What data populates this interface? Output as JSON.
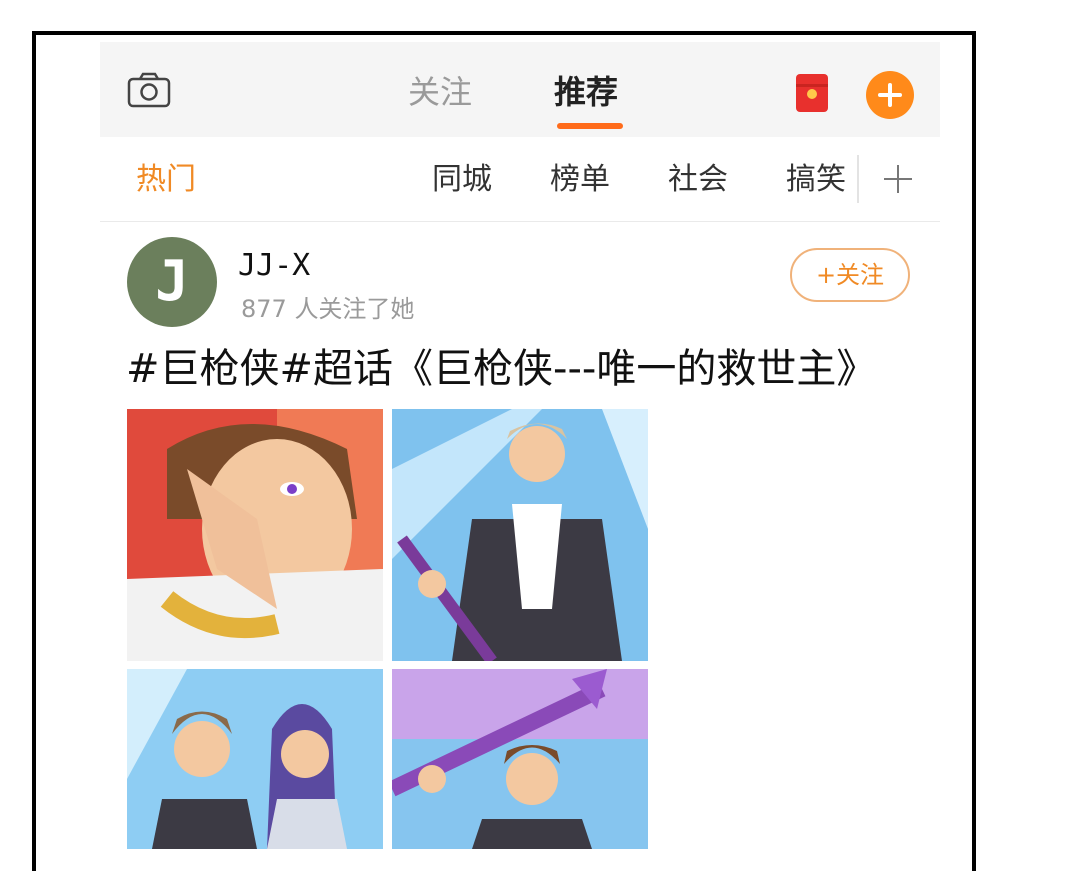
{
  "topbar": {
    "tabs": [
      {
        "label": "关注",
        "active": false
      },
      {
        "label": "推荐",
        "active": true
      }
    ],
    "camera_icon": "camera-icon",
    "redpacket_icon": "red-packet-icon",
    "add_icon": "plus-circle-icon",
    "accent_color": "#ff6b1a"
  },
  "categories": {
    "items": [
      "热门",
      "同城",
      "榜单",
      "社会",
      "搞笑"
    ],
    "active_index": 0,
    "active_color": "#f08a25",
    "add_icon": "plus-icon"
  },
  "post": {
    "avatar_text": "J",
    "username": "JJ-X",
    "followers_text": "877 人关注了她",
    "follow_button": "+关注",
    "text": "#巨枪侠#超话《巨枪侠---唯一的救世主》",
    "images": [
      {
        "alt": "comic-panel-face-cover"
      },
      {
        "alt": "comic-panel-spear-stage"
      },
      {
        "alt": "comic-panel-two-characters"
      },
      {
        "alt": "comic-panel-raised-spear"
      }
    ]
  }
}
